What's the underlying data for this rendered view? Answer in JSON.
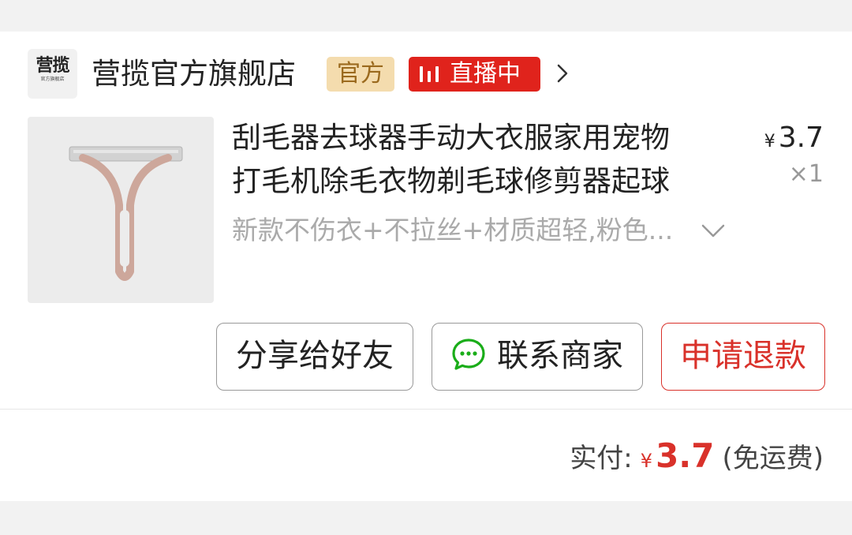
{
  "store": {
    "logo_line1": "营揽",
    "logo_line2": "官方旗舰店",
    "name": "营揽官方旗舰店",
    "official_badge": "官方",
    "live_badge": "直播中"
  },
  "product": {
    "title_line1": "刮毛器去球器手动大衣服家用宠物",
    "title_line2": "打毛机除毛衣物剃毛球修剪器起球",
    "sku": "新款不伤衣+不拉丝+材质超轻,粉色...",
    "currency": "¥",
    "price": "3.7",
    "quantity": "×1"
  },
  "actions": {
    "share": "分享给好友",
    "contact": "联系商家",
    "refund": "申请退款"
  },
  "payment": {
    "label": "实付:",
    "currency": "¥",
    "amount": "3.7",
    "shipping_note": "(免运费)"
  },
  "colors": {
    "accent_red": "#d9312a",
    "live_red": "#e0231c",
    "official_bg": "#f4dcae",
    "wechat_green": "#1aad19"
  },
  "icons": {
    "live": "live-bars-icon",
    "store_link": "chevron-right-icon",
    "sku_expand": "chevron-down-icon",
    "contact": "chat-bubble-icon"
  }
}
